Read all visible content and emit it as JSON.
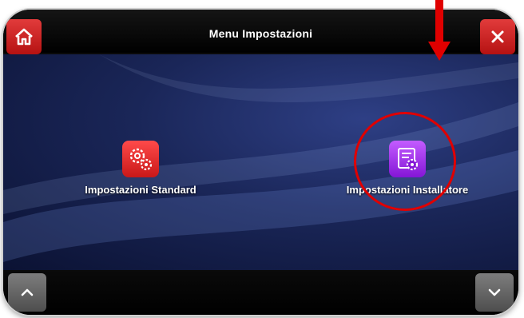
{
  "header": {
    "title": "Menu Impostazioni"
  },
  "menu": {
    "items": [
      {
        "label": "Impostazioni Standard",
        "icon": "gears-icon",
        "color": "#e02424"
      },
      {
        "label": "Impostazioni Installatore",
        "icon": "installer-settings-icon",
        "color": "#a02ae6"
      }
    ]
  },
  "toolbar": {
    "home_icon": "home-icon",
    "close_icon": "close-icon"
  },
  "nav": {
    "up_icon": "chevron-up-icon",
    "down_icon": "chevron-down-icon"
  },
  "annotations": {
    "highlight_color": "#e00000"
  }
}
